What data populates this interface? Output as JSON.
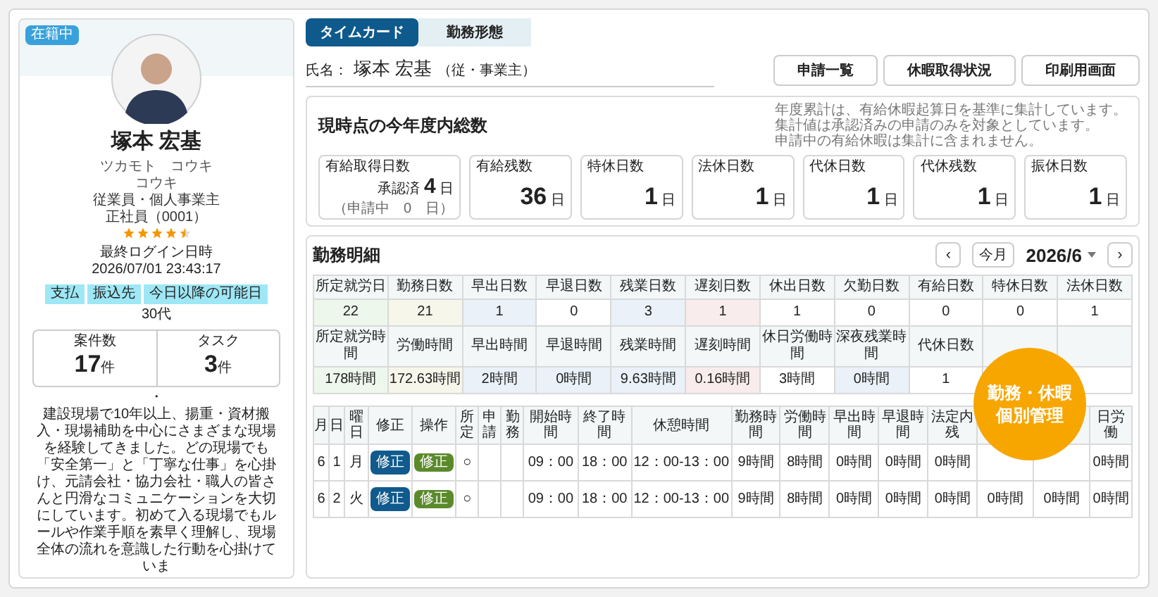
{
  "profile": {
    "status": "在籍中",
    "name": "塚本 宏基",
    "kana": "ツカモト　コウキ",
    "nickname": "コウキ",
    "category": "従業員・個人事業主",
    "employment": "正社員（0001）",
    "stars": 4.5,
    "last_login_label": "最終ログイン日時",
    "last_login": "2026/07/01 23:43:17",
    "tags": [
      "支払",
      "振込先",
      "今日以降の可能日"
    ],
    "age": "30代",
    "stats": [
      {
        "label": "案件数",
        "value": "17",
        "unit": "件"
      },
      {
        "label": "タスク",
        "value": "3",
        "unit": "件"
      }
    ],
    "separator": "・",
    "bio": "建設現場で10年以上、揚重・資材搬入・現場補助を中心にさまざまな現場を経験してきました。どの現場でも「安全第一」と「丁寧な仕事」を心掛け、元請会社・協力会社・職人の皆さんと円滑なコミュニケーションを大切にしています。初めて入る現場でもルールや作業手順を素早く理解し、現場全体の流れを意識した行動を心掛けていま"
  },
  "tabs": [
    {
      "label": "タイムカード",
      "selected": true
    },
    {
      "label": "勤務形態",
      "selected": false
    }
  ],
  "employee": {
    "label": "氏名：",
    "name": "塚本 宏基",
    "type": "（従・事業主）"
  },
  "buttons": [
    "申請一覧",
    "休暇取得状況",
    "印刷用画面"
  ],
  "summary": {
    "title": "現時点の今年度内総数",
    "notes": [
      "年度累計は、有給休暇起算日を基準に集計しています。",
      "集計値は承認済みの申請のみを対象としています。",
      "申請中の有給休暇は集計に含まれません。"
    ],
    "cards": [
      {
        "kind": "paid",
        "label": "有給取得日数",
        "approved_label": "承認済",
        "value": "4",
        "unit": "日",
        "pending": "（申請中　0　日）"
      },
      {
        "kind": "plain",
        "label": "有給残数",
        "value": "36",
        "unit": "日"
      },
      {
        "kind": "plain",
        "label": "特休日数",
        "value": "1",
        "unit": "日"
      },
      {
        "kind": "plain",
        "label": "法休日数",
        "value": "1",
        "unit": "日"
      },
      {
        "kind": "plain",
        "label": "代休日数",
        "value": "1",
        "unit": "日"
      },
      {
        "kind": "plain",
        "label": "代休残数",
        "value": "1",
        "unit": "日"
      },
      {
        "kind": "plain",
        "label": "振休日数",
        "value": "1",
        "unit": "日"
      }
    ]
  },
  "detail": {
    "title": "勤務明細",
    "prev": "‹",
    "today": "今月",
    "month": "2026/6",
    "next": "›",
    "stats_rows": [
      {
        "kind": "header",
        "cells": [
          {
            "text": "所定就労日"
          },
          {
            "text": "勤務日数"
          },
          {
            "text": "早出日数"
          },
          {
            "text": "早退日数"
          },
          {
            "text": "残業日数"
          },
          {
            "text": "遅刻日数"
          },
          {
            "text": "休出日数"
          },
          {
            "text": "欠勤日数"
          },
          {
            "text": "有給日数"
          },
          {
            "text": "特休日数"
          },
          {
            "text": "法休日数"
          }
        ]
      },
      {
        "kind": "value",
        "cells": [
          {
            "text": "22",
            "color": "#eef7ec"
          },
          {
            "text": "21",
            "color": "#f7f6ea"
          },
          {
            "text": "1",
            "color": "#eaf1f8"
          },
          {
            "text": "0",
            "color": "#ffffff"
          },
          {
            "text": "3",
            "color": "#eaf1f8"
          },
          {
            "text": "1",
            "color": "#f9ecec"
          },
          {
            "text": "1",
            "color": "#ffffff"
          },
          {
            "text": "0",
            "color": "#ffffff"
          },
          {
            "text": "0",
            "color": "#ffffff"
          },
          {
            "text": "0",
            "color": "#ffffff"
          },
          {
            "text": "1",
            "color": "#ffffff"
          }
        ]
      },
      {
        "kind": "header",
        "cells": [
          {
            "text": "所定就労時間"
          },
          {
            "text": "労働時間"
          },
          {
            "text": "早出時間"
          },
          {
            "text": "早退時間"
          },
          {
            "text": "残業時間"
          },
          {
            "text": "遅刻時間"
          },
          {
            "text": "休日労働時間"
          },
          {
            "text": "深夜残業時間"
          },
          {
            "text": "代休日数"
          },
          {},
          {}
        ]
      },
      {
        "kind": "value",
        "cells": [
          {
            "text": "178時間",
            "color": "#eef7ec"
          },
          {
            "text": "172.63時間",
            "color": "#f7f6ea"
          },
          {
            "text": "2時間",
            "color": "#eaf1f8"
          },
          {
            "text": "0時間",
            "color": "#eaf1f8"
          },
          {
            "text": "9.63時間",
            "color": "#eaf1f8"
          },
          {
            "text": "0.16時間",
            "color": "#f9ecec"
          },
          {
            "text": "3時間",
            "color": "#ffffff"
          },
          {
            "text": "0時間",
            "color": "#eaf1f8"
          },
          {
            "text": "1",
            "color": "#ffffff"
          },
          {},
          {}
        ]
      }
    ],
    "columns": [
      {
        "label": "月"
      },
      {
        "label": "日"
      },
      {
        "label": "曜日"
      },
      {
        "label": "修正"
      },
      {
        "label": "操作"
      },
      {
        "label": "所定"
      },
      {
        "label": "申請"
      },
      {
        "label": "勤務"
      },
      {
        "label": "開始時間"
      },
      {
        "label": "終了時間"
      },
      {
        "label": "休憩時間"
      },
      {
        "label": "勤務時間"
      },
      {
        "label": "労働時間"
      },
      {
        "label": "早出時間"
      },
      {
        "label": "早退時間"
      },
      {
        "label": "法定内残"
      },
      {},
      {},
      {
        "label": "日労働"
      }
    ],
    "rows": [
      {
        "cells": [
          {
            "kind": "text",
            "text": "6"
          },
          {
            "kind": "text",
            "text": "1"
          },
          {
            "kind": "text",
            "text": "月"
          },
          {
            "kind": "button",
            "text": "修正"
          },
          {
            "kind": "tag",
            "text": "修正"
          },
          {
            "kind": "circle",
            "text": "○"
          },
          {
            "kind": "empty"
          },
          {
            "kind": "empty"
          },
          {
            "kind": "text",
            "text": "09：00"
          },
          {
            "kind": "text",
            "text": "18：00"
          },
          {
            "kind": "text",
            "text": "12：00-13：00"
          },
          {
            "kind": "text",
            "text": "9時間"
          },
          {
            "kind": "text",
            "text": "8時間"
          },
          {
            "kind": "text",
            "text": "0時間"
          },
          {
            "kind": "text",
            "text": "0時間"
          },
          {
            "kind": "text",
            "text": "0時間"
          },
          {
            "kind": "empty"
          },
          {
            "kind": "empty"
          },
          {
            "kind": "text",
            "text": "0時間"
          }
        ]
      },
      {
        "cells": [
          {
            "kind": "text",
            "text": "6"
          },
          {
            "kind": "text",
            "text": "2"
          },
          {
            "kind": "text",
            "text": "火"
          },
          {
            "kind": "button",
            "text": "修正"
          },
          {
            "kind": "tag",
            "text": "修正"
          },
          {
            "kind": "circle",
            "text": "○"
          },
          {
            "kind": "empty"
          },
          {
            "kind": "empty"
          },
          {
            "kind": "text",
            "text": "09：00"
          },
          {
            "kind": "text",
            "text": "18：00"
          },
          {
            "kind": "text",
            "text": "12：00-13：00"
          },
          {
            "kind": "text",
            "text": "9時間"
          },
          {
            "kind": "text",
            "text": "8時間"
          },
          {
            "kind": "text",
            "text": "0時間"
          },
          {
            "kind": "text",
            "text": "0時間"
          },
          {
            "kind": "text",
            "text": "0時間"
          },
          {
            "kind": "text",
            "text": "0時間"
          },
          {
            "kind": "text",
            "text": "0時間"
          },
          {
            "kind": "text",
            "text": "0時間"
          }
        ]
      }
    ]
  },
  "badge": {
    "lines": [
      "勤務・休暇",
      "個別管理"
    ]
  }
}
